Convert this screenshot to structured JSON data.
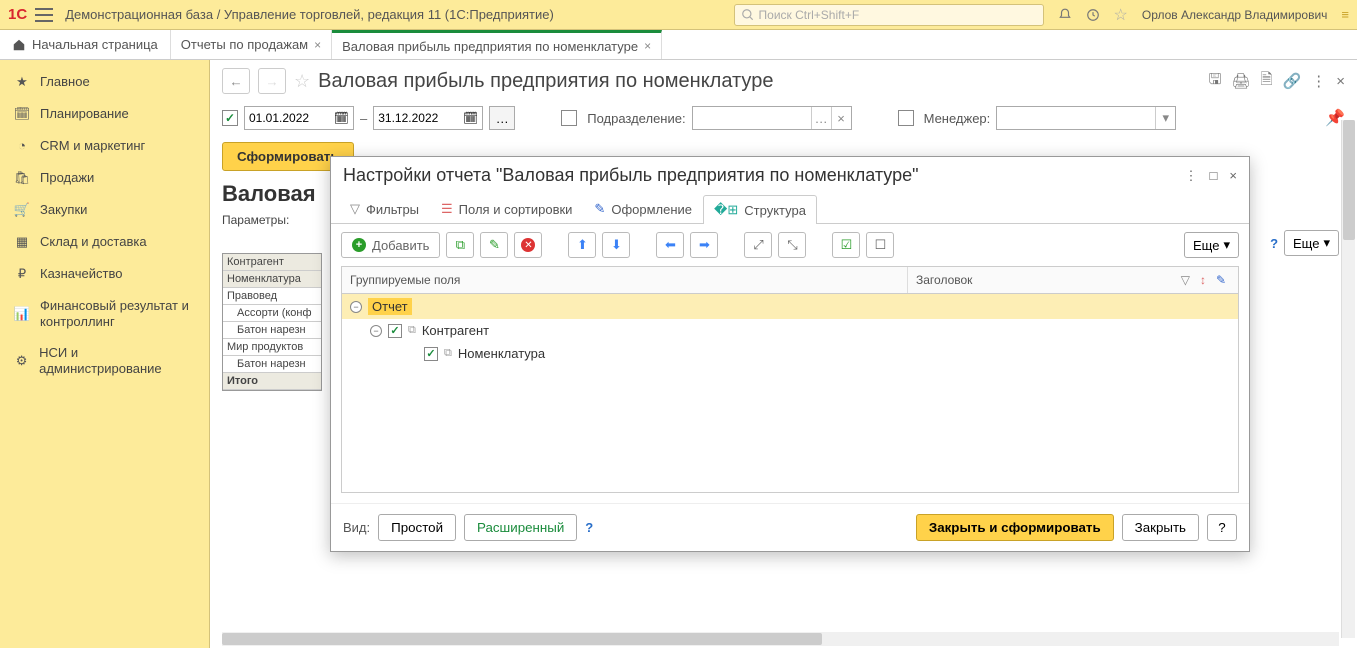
{
  "topbar": {
    "logo": "1C",
    "title": "Демонстрационная база / Управление торговлей, редакция 11  (1С:Предприятие)",
    "search_placeholder": "Поиск Ctrl+Shift+F",
    "username": "Орлов Александр Владимирович"
  },
  "tabs": {
    "home": "Начальная страница",
    "items": [
      {
        "label": "Отчеты по продажам",
        "active": false
      },
      {
        "label": "Валовая прибыль предприятия по номенклатуре",
        "active": true
      }
    ]
  },
  "sidebar": {
    "items": [
      "Главное",
      "Планирование",
      "CRM и маркетинг",
      "Продажи",
      "Закупки",
      "Склад и доставка",
      "Казначейство",
      "Финансовый результат и контроллинг",
      "НСИ и администрирование"
    ]
  },
  "page": {
    "title": "Валовая прибыль предприятия по номенклатуре",
    "date_from": "01.01.2022",
    "date_to": "31.12.2022",
    "filter_subdivision_label": "Подразделение:",
    "filter_manager_label": "Менеджер:",
    "btn_form": "Сформировать",
    "btn_more": "Еще",
    "report_title": "Валовая",
    "params_label": "Параметры:",
    "grid_rows": [
      "Контрагент",
      "Номенклатура",
      "Правовед",
      "Ассорти (конф",
      "Батон нарезн",
      "Мир продуктов",
      "Батон нарезн",
      "Итого"
    ]
  },
  "dialog": {
    "title": "Настройки отчета \"Валовая прибыль предприятия по номенклатуре\"",
    "tabs": [
      "Фильтры",
      "Поля и сортировки",
      "Оформление",
      "Структура"
    ],
    "active_tab": 3,
    "btn_add": "Добавить",
    "btn_more": "Еще",
    "col_group": "Группируемые поля",
    "col_header": "Заголовок",
    "tree": {
      "root": "Отчет",
      "level1": "Контрагент",
      "level2": "Номенклатура"
    },
    "footer": {
      "vid": "Вид:",
      "simple": "Простой",
      "advanced": "Расширенный",
      "close_form": "Закрыть и сформировать",
      "close": "Закрыть"
    }
  }
}
